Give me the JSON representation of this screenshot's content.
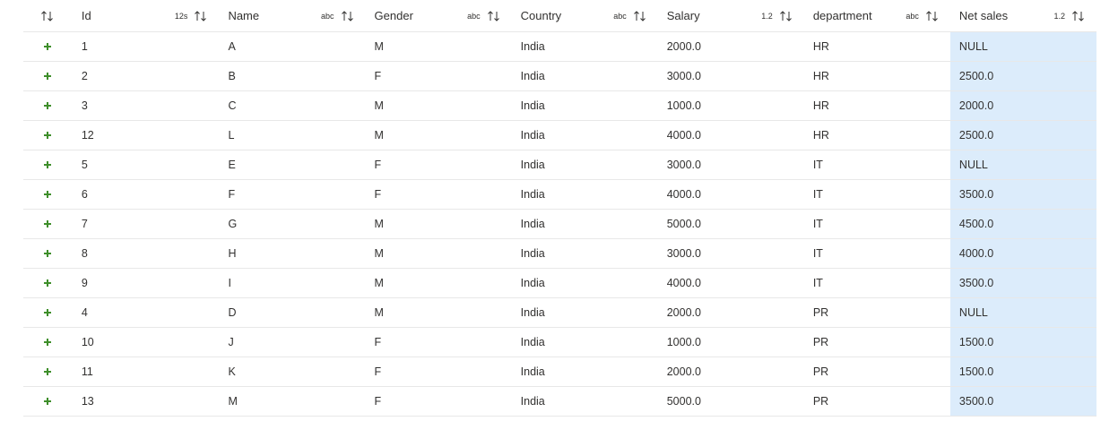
{
  "columns": [
    {
      "name": "Id",
      "type": "12s"
    },
    {
      "name": "Name",
      "type": "abc"
    },
    {
      "name": "Gender",
      "type": "abc"
    },
    {
      "name": "Country",
      "type": "abc"
    },
    {
      "name": "Salary",
      "type": "1.2"
    },
    {
      "name": "department",
      "type": "abc"
    },
    {
      "name": "Net sales",
      "type": "1.2"
    }
  ],
  "rows": [
    {
      "id": "1",
      "name": "A",
      "gender": "M",
      "country": "India",
      "salary": "2000.0",
      "department": "HR",
      "net_sales": "NULL"
    },
    {
      "id": "2",
      "name": "B",
      "gender": "F",
      "country": "India",
      "salary": "3000.0",
      "department": "HR",
      "net_sales": "2500.0"
    },
    {
      "id": "3",
      "name": "C",
      "gender": "M",
      "country": "India",
      "salary": "1000.0",
      "department": "HR",
      "net_sales": "2000.0"
    },
    {
      "id": "12",
      "name": "L",
      "gender": "M",
      "country": "India",
      "salary": "4000.0",
      "department": "HR",
      "net_sales": "2500.0"
    },
    {
      "id": "5",
      "name": "E",
      "gender": "F",
      "country": "India",
      "salary": "3000.0",
      "department": "IT",
      "net_sales": "NULL"
    },
    {
      "id": "6",
      "name": "F",
      "gender": "F",
      "country": "India",
      "salary": "4000.0",
      "department": "IT",
      "net_sales": "3500.0"
    },
    {
      "id": "7",
      "name": "G",
      "gender": "M",
      "country": "India",
      "salary": "5000.0",
      "department": "IT",
      "net_sales": "4500.0"
    },
    {
      "id": "8",
      "name": "H",
      "gender": "M",
      "country": "India",
      "salary": "3000.0",
      "department": "IT",
      "net_sales": "4000.0"
    },
    {
      "id": "9",
      "name": "I",
      "gender": "M",
      "country": "India",
      "salary": "4000.0",
      "department": "IT",
      "net_sales": "3500.0"
    },
    {
      "id": "4",
      "name": "D",
      "gender": "M",
      "country": "India",
      "salary": "2000.0",
      "department": "PR",
      "net_sales": "NULL"
    },
    {
      "id": "10",
      "name": "J",
      "gender": "F",
      "country": "India",
      "salary": "1000.0",
      "department": "PR",
      "net_sales": "1500.0"
    },
    {
      "id": "11",
      "name": "K",
      "gender": "F",
      "country": "India",
      "salary": "2000.0",
      "department": "PR",
      "net_sales": "1500.0"
    },
    {
      "id": "13",
      "name": "M",
      "gender": "F",
      "country": "India",
      "salary": "5000.0",
      "department": "PR",
      "net_sales": "3500.0"
    }
  ],
  "icons": {
    "sort": "sort-arrows-icon",
    "row_marker": "plus-icon"
  },
  "colors": {
    "highlight": "#dcecfb",
    "null_text": "#a19f9d",
    "plus": "#3e8e2a"
  }
}
